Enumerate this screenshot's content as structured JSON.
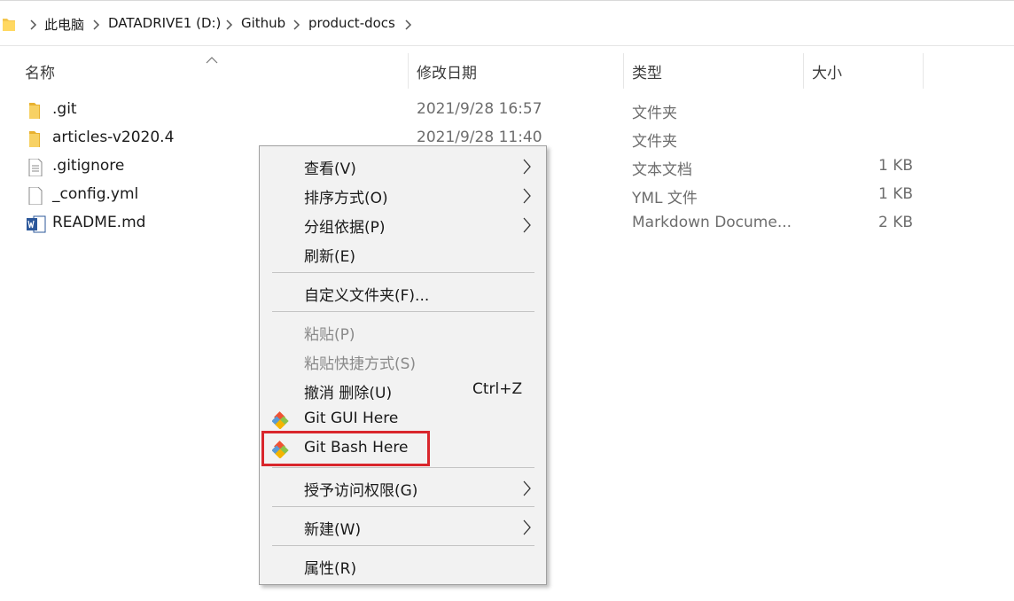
{
  "address_bar": {
    "crumbs": [
      "此电脑",
      "DATADRIVE1 (D:)",
      "Github",
      "product-docs"
    ]
  },
  "columns": {
    "name": "名称",
    "date": "修改日期",
    "type": "类型",
    "size": "大小"
  },
  "files": [
    {
      "name": ".git",
      "date": "2021/9/28 16:57",
      "type": "文件夹",
      "size": "",
      "icon": "folder-icon"
    },
    {
      "name": "articles-v2020.4",
      "date": "2021/9/28 11:40",
      "type": "文件夹",
      "size": "",
      "icon": "folder-icon"
    },
    {
      "name": ".gitignore",
      "date": "",
      "type": "文本文档",
      "size": "1 KB",
      "icon": "text-file-icon"
    },
    {
      "name": "_config.yml",
      "date": "",
      "type": "YML 文件",
      "size": "1 KB",
      "icon": "file-icon"
    },
    {
      "name": "README.md",
      "date": "",
      "type": "Markdown Docume...",
      "size": "2 KB",
      "icon": "word-icon"
    }
  ],
  "context_menu": {
    "view": "查看(V)",
    "sort_by": "排序方式(O)",
    "group_by": "分组依据(P)",
    "refresh": "刷新(E)",
    "customize_folder": "自定义文件夹(F)...",
    "paste": "粘贴(P)",
    "paste_shortcut": "粘贴快捷方式(S)",
    "undo_delete": "撤消 删除(U)",
    "undo_shortcut": "Ctrl+Z",
    "git_gui": "Git GUI Here",
    "git_bash": "Git Bash Here",
    "give_access": "授予访问权限(G)",
    "new": "新建(W)",
    "properties": "属性(R)"
  },
  "colors": {
    "highlight_border": "#d9262c",
    "menu_background": "#f2f2f2",
    "folder_yellow": "#f4c64e"
  }
}
